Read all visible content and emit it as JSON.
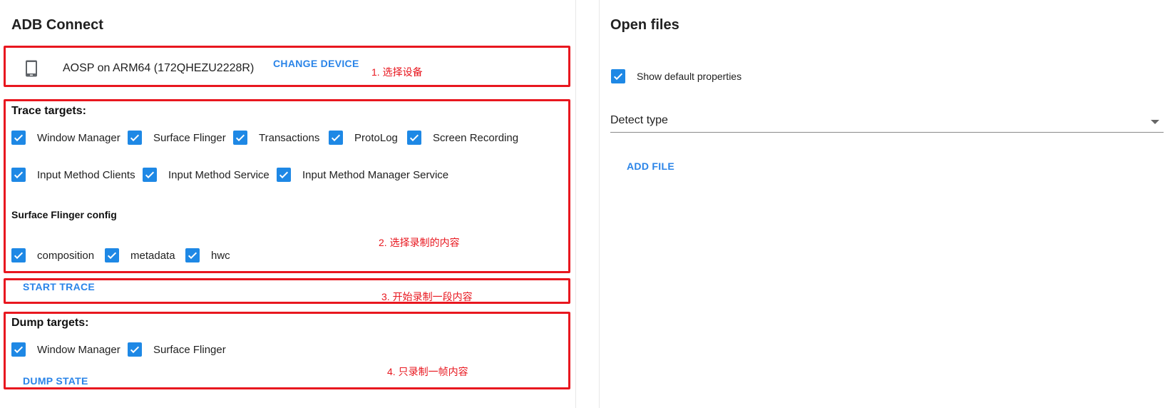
{
  "adb": {
    "title": "ADB Connect",
    "device_label": "AOSP on ARM64 (172QHEZU2228R)",
    "change_device_label": "CHANGE DEVICE",
    "trace_targets_title": "Trace targets:",
    "trace_targets": [
      {
        "label": "Window Manager",
        "checked": true
      },
      {
        "label": "Surface Flinger",
        "checked": true
      },
      {
        "label": "Transactions",
        "checked": true
      },
      {
        "label": "ProtoLog",
        "checked": true
      },
      {
        "label": "Screen Recording",
        "checked": true
      },
      {
        "label": "Input Method Clients",
        "checked": true
      },
      {
        "label": "Input Method Service",
        "checked": true
      },
      {
        "label": "Input Method Manager Service",
        "checked": true
      }
    ],
    "sf_config_title": "Surface Flinger config",
    "sf_config": [
      {
        "label": "composition",
        "checked": true
      },
      {
        "label": "metadata",
        "checked": true
      },
      {
        "label": "hwc",
        "checked": true
      }
    ],
    "start_trace_label": "START TRACE",
    "dump_targets_title": "Dump targets:",
    "dump_targets": [
      {
        "label": "Window Manager",
        "checked": true
      },
      {
        "label": "Surface Flinger",
        "checked": true
      }
    ],
    "dump_state_label": "DUMP STATE"
  },
  "annotations": {
    "a1": "1. 选择设备",
    "a2": "2. 选择录制的内容",
    "a3": "3. 开始录制一段内容",
    "a4": "4. 只录制一帧内容"
  },
  "open_files": {
    "title": "Open files",
    "show_default_label": "Show default properties",
    "show_default_checked": true,
    "detect_type_value": "Detect type",
    "add_file_label": "ADD FILE"
  },
  "colors": {
    "accent": "#1e88e5",
    "link": "#2a84e8",
    "annotation": "#e8171f"
  },
  "icons": {
    "device": "phone-icon",
    "check": "check-icon",
    "dropdown": "chevron-down-icon"
  }
}
